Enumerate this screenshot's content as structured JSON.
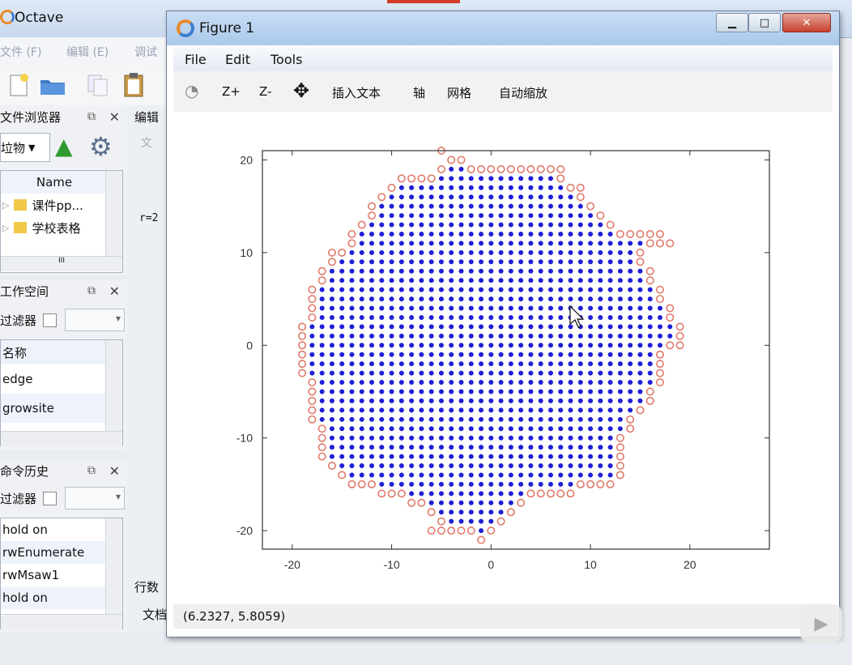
{
  "main_window": {
    "title": "Octave",
    "menu": [
      "文件 (F)",
      "编辑 (E)",
      "调试"
    ],
    "file_browser": {
      "title": "文件浏览器",
      "path": "垃物",
      "column": "Name",
      "items": [
        "课件pp...",
        "学校表格"
      ],
      "scroll_dots": "III"
    },
    "workspace": {
      "title": "工作空间",
      "filter_label": "过滤器",
      "column": "名称",
      "items": [
        "edge",
        "growsite"
      ]
    },
    "history": {
      "title": "命令历史",
      "filter_label": "过滤器",
      "items": [
        "hold on",
        "rwEnumerate",
        "rwMsaw1",
        "hold on"
      ]
    },
    "editor": {
      "tab": "编辑",
      "file_tab": "文",
      "code_tab": "r=2",
      "rows_label": "行数",
      "doc_tab": "文档"
    }
  },
  "figure": {
    "title": "Figure 1",
    "menu": [
      "File",
      "Edit",
      "Tools"
    ],
    "toolbar": [
      "Z+",
      "Z-",
      "插入文本",
      "轴",
      "网格",
      "自动缩放"
    ],
    "status": "(6.2327, 5.8059)"
  },
  "chart_data": {
    "type": "scatter",
    "title": "",
    "xlabel": "",
    "ylabel": "",
    "xlim": [
      -23,
      28
    ],
    "ylim": [
      -22,
      21
    ],
    "xticks": [
      -20,
      -10,
      0,
      10,
      20
    ],
    "yticks": [
      -20,
      -10,
      0,
      10,
      20
    ],
    "grid": false,
    "legend": "none",
    "series": [
      {
        "marker": "filled-dot",
        "color": "#1f1fd6",
        "description": "integer lattice sites of a random growth cluster (interior)"
      },
      {
        "marker": "open-circle",
        "color": "#e07a6a",
        "description": "integer lattice sites on the cluster boundary (perimeter)"
      }
    ],
    "rows": [
      [
        -21,
        -1,
        -1
      ],
      [
        -20,
        -6,
        0
      ],
      [
        -19,
        -5,
        1
      ],
      [
        -18,
        -6,
        2
      ],
      [
        -17,
        -8,
        3
      ],
      [
        -16,
        -11,
        8
      ],
      [
        -15,
        -14,
        12
      ],
      [
        -14,
        -15,
        13
      ],
      [
        -13,
        -16,
        13
      ],
      [
        -12,
        -17,
        13
      ],
      [
        -11,
        -17,
        13
      ],
      [
        -10,
        -17,
        13
      ],
      [
        -9,
        -17,
        14
      ],
      [
        -8,
        -18,
        14
      ],
      [
        -7,
        -18,
        15
      ],
      [
        -6,
        -18,
        16
      ],
      [
        -5,
        -18,
        16
      ],
      [
        -4,
        -18,
        17
      ],
      [
        -3,
        -19,
        17
      ],
      [
        -2,
        -19,
        17
      ],
      [
        -1,
        -19,
        17
      ],
      [
        0,
        -19,
        19
      ],
      [
        1,
        -19,
        19
      ],
      [
        2,
        -19,
        19
      ],
      [
        3,
        -18,
        18
      ],
      [
        4,
        -18,
        18
      ],
      [
        5,
        -18,
        17
      ],
      [
        6,
        -18,
        17
      ],
      [
        7,
        -17,
        16
      ],
      [
        8,
        -17,
        16
      ],
      [
        9,
        -16,
        15
      ],
      [
        10,
        -16,
        15
      ],
      [
        11,
        -14,
        18
      ],
      [
        12,
        -14,
        17
      ],
      [
        13,
        -13,
        12
      ],
      [
        14,
        -12,
        11
      ],
      [
        15,
        -12,
        10
      ],
      [
        16,
        -11,
        9
      ],
      [
        17,
        -10,
        9
      ],
      [
        18,
        -9,
        7
      ],
      [
        19,
        -5,
        7
      ],
      [
        20,
        -4,
        -3
      ],
      [
        21,
        -5,
        -5
      ]
    ]
  },
  "colors": {
    "interior": "#1f1fd6",
    "boundary": "#e07a6a",
    "accent_orange": "#e88a2b"
  }
}
